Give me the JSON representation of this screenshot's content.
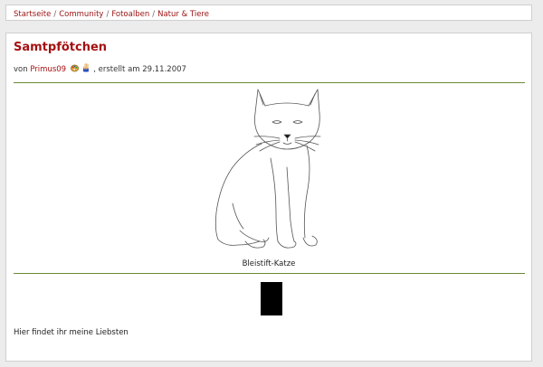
{
  "breadcrumb": {
    "items": [
      "Startseite",
      "Community",
      "Fotoalben",
      "Natur & Tiere"
    ],
    "separator": "/"
  },
  "album": {
    "title": "Samtpfötchen",
    "by_prefix": "von",
    "username": "Primus09",
    "created_text": ", erstellt am 29.11.2007",
    "user_icons": [
      "palette-icon",
      "waving-hand-icon"
    ]
  },
  "photo": {
    "caption": "Bleistift-Katze",
    "description": "Hier findet ihr meine Liebsten"
  },
  "colors": {
    "accent_red": "#a51010",
    "rule_green": "#6a8a34"
  }
}
